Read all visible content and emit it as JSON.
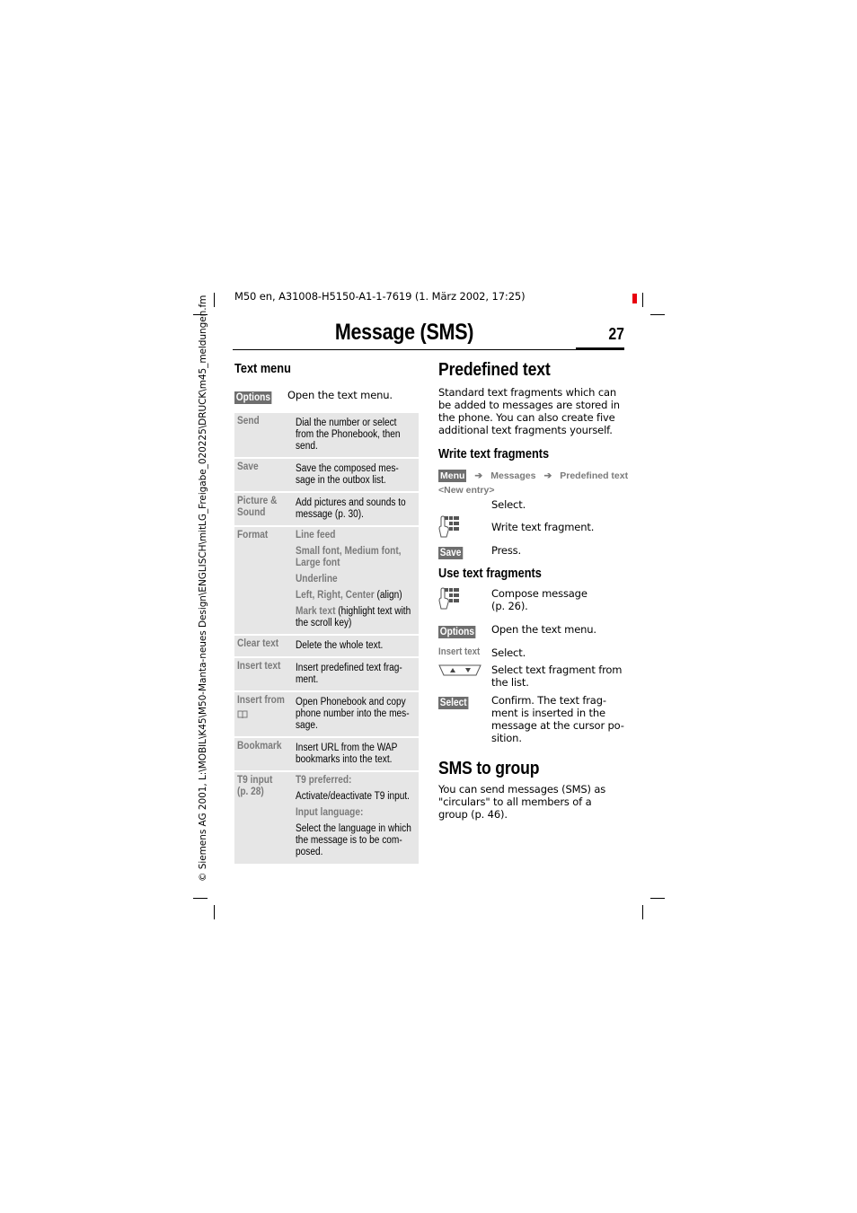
{
  "print_header": "M50 en, A31008-H5150-A1-1-7619 (1. März 2002, 17:25)",
  "side_note": "© Siemens AG 2001, L:\\MOBIL\\K45\\M50-Manta-neues Design\\ENGLISCH\\mitLG_Freigabe_020225\\DRUCK\\m45_meldungen.fm",
  "page": {
    "title": "Message (SMS)",
    "number": "27"
  },
  "text_menu": {
    "heading": "Text menu",
    "options_key": "Options",
    "options_desc": "Open the text menu.",
    "rows": [
      {
        "label": "Send",
        "desc": "Dial the number or select from the Phonebook, then send."
      },
      {
        "label": "Save",
        "desc": "Save the composed mes-sage in the outbox list."
      },
      {
        "label": "Picture & Sound",
        "desc": "Add pictures and sounds to message (p. 30)."
      },
      {
        "label": "Format",
        "items": [
          {
            "highlight": "Line feed",
            "rest": ""
          },
          {
            "highlight": "Small font, Medium font, Large font",
            "rest": ""
          },
          {
            "highlight": "Underline",
            "rest": ""
          },
          {
            "highlight": "Left, Right, Center",
            "rest": " (align)"
          },
          {
            "highlight": "Mark text",
            "rest": " (highlight text with the scroll key)"
          }
        ]
      },
      {
        "label": "Clear text",
        "desc": "Delete the whole text."
      },
      {
        "label": "Insert text",
        "desc": "Insert predefined text frag-ment."
      },
      {
        "label": "Insert from",
        "label_icon": "phonebook-icon",
        "desc": "Open Phonebook and copy phone number into the mes-sage."
      },
      {
        "label": "Bookmark",
        "desc": "Insert URL from the WAP bookmarks into the text."
      },
      {
        "label": "T9 input",
        "label2": "(p. 28)",
        "items": [
          {
            "highlight": "T9 preferred:",
            "rest": ""
          },
          {
            "highlight": "",
            "rest": "Activate/deactivate T9 input."
          },
          {
            "highlight": "Input language:",
            "rest": ""
          },
          {
            "highlight": "",
            "rest": "Select the language in which the message is to be com-posed."
          }
        ]
      }
    ]
  },
  "predefined_text": {
    "heading": "Predefined text",
    "intro": "Standard text fragments which can be added to messages are stored in the phone. You can also create five additional text fragments yourself.",
    "write": {
      "heading": "Write text fragments",
      "menu_key": "Menu",
      "path": [
        "Messages",
        "Predefined text"
      ],
      "arrow": "➔",
      "new_entry": "<New entry>",
      "new_entry_desc": "Select.",
      "keypad_desc": "Write text fragment.",
      "save_key": "Save",
      "save_desc": "Press."
    },
    "use": {
      "heading": "Use text fragments",
      "keypad_desc": "Compose message (p. 26).",
      "options_key": "Options",
      "options_desc": "Open the text menu.",
      "insert_label": "Insert text",
      "insert_desc": "Select.",
      "nav_desc": "Select text fragment from the list.",
      "select_key": "Select",
      "select_desc": "Confirm. The text frag-ment is inserted in the message at the cursor po-sition."
    }
  },
  "sms_group": {
    "heading": "SMS to group",
    "text": "You can send messages (SMS) as \"circulars\" to all members of a group (p. 46)."
  },
  "colors": {
    "accent_red": "#e8000f",
    "key_bg": "#6e6e6e",
    "table_bg": "#e6e6e6",
    "grey_label": "#7a7a7a"
  }
}
